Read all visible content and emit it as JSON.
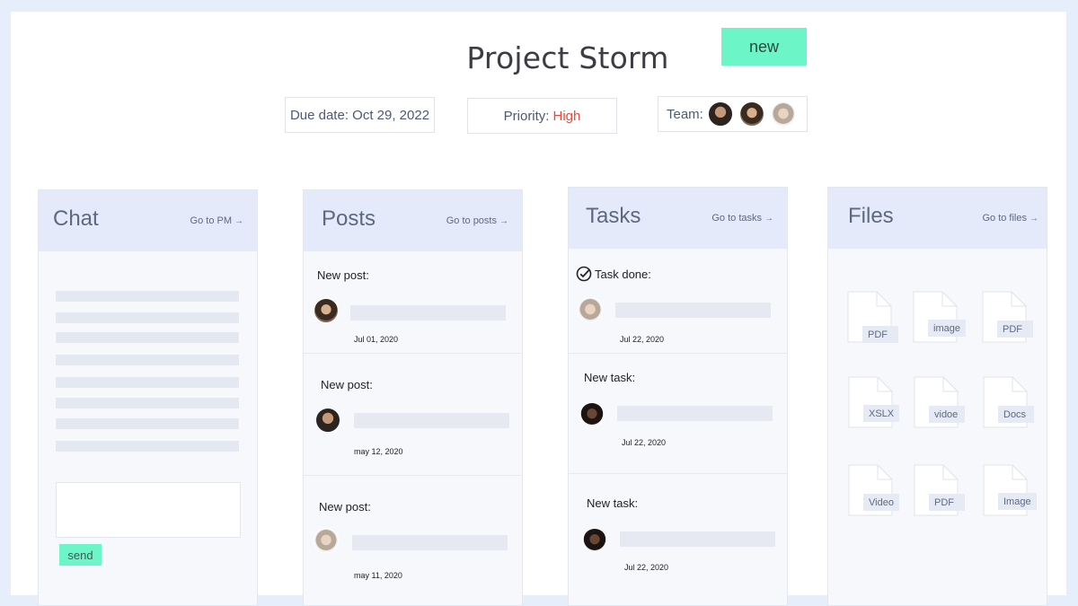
{
  "header": {
    "title": "Project Storm",
    "badge": "new",
    "due_date": "Due date: Oct 29, 2022",
    "priority_label": "Priority:",
    "priority_value": "High",
    "team_label": "Team:"
  },
  "colors": {
    "accent": "#6cf5c6",
    "priority_high": "#e24b3b",
    "panel_header": "#e4eafa"
  },
  "chat": {
    "title": "Chat",
    "link": "Go to PM",
    "send_label": "send"
  },
  "posts": {
    "title": "Posts",
    "link": "Go to posts",
    "items": [
      {
        "label": "New post:",
        "date": "Jul 01, 2020"
      },
      {
        "label": "New post:",
        "date": "may 12, 2020"
      },
      {
        "label": "New post:",
        "date": "may 11, 2020"
      }
    ]
  },
  "tasks": {
    "title": "Tasks",
    "link": "Go to tasks",
    "items": [
      {
        "label": "Task done:",
        "date": "Jul 22, 2020"
      },
      {
        "label": "New task:",
        "date": "Jul 22, 2020"
      },
      {
        "label": "New task:",
        "date": "Jul 22, 2020"
      }
    ]
  },
  "files": {
    "title": "Files",
    "link": "Go to files",
    "items": [
      "PDF",
      "image",
      "PDF",
      "XSLX",
      "vidoe",
      "Docs",
      "Video",
      "PDF",
      "Image"
    ]
  }
}
